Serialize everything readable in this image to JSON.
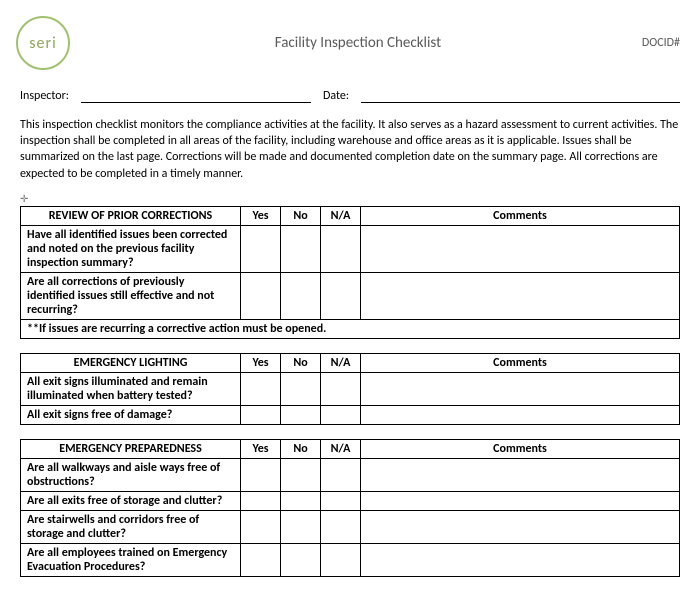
{
  "header": {
    "logo_text": "seri",
    "title": "Facility Inspection Checklist",
    "docid_label": "DOCID#"
  },
  "meta": {
    "inspector_label": "Inspector:",
    "date_label": "Date:"
  },
  "intro": "This inspection checklist monitors the compliance activities at the facility.  It also serves as a hazard assessment to current activities.  The inspection shall be completed in all areas of the facility, including warehouse and office areas as it is applicable.  Issues shall be summarized on the last page.  Corrections will be made and documented completion date on the summary page.   All corrections are expected to be completed in a timely manner.",
  "columns": {
    "yes": "Yes",
    "no": "No",
    "na": "N/A",
    "comments": "Comments"
  },
  "anchor_glyph": "✛",
  "sections": [
    {
      "heading": "REVIEW OF PRIOR CORRECTIONS",
      "rows": [
        "Have all identified issues been corrected and noted on the previous facility inspection summary?",
        "Are all corrections of previously identified issues still effective and not recurring?"
      ],
      "footnote": "**If issues are recurring a corrective action must be opened."
    },
    {
      "heading": "EMERGENCY LIGHTING",
      "rows": [
        "All exit signs illuminated and remain illuminated when battery tested?",
        "All exit signs free of damage?"
      ]
    },
    {
      "heading": "EMERGENCY PREPAREDNESS",
      "rows": [
        "Are all walkways and aisle ways free of obstructions?",
        "Are all exits free of storage and clutter?",
        "Are stairwells and corridors free of storage and clutter?",
        "Are all employees trained on Emergency Evacuation Procedures?"
      ]
    }
  ]
}
